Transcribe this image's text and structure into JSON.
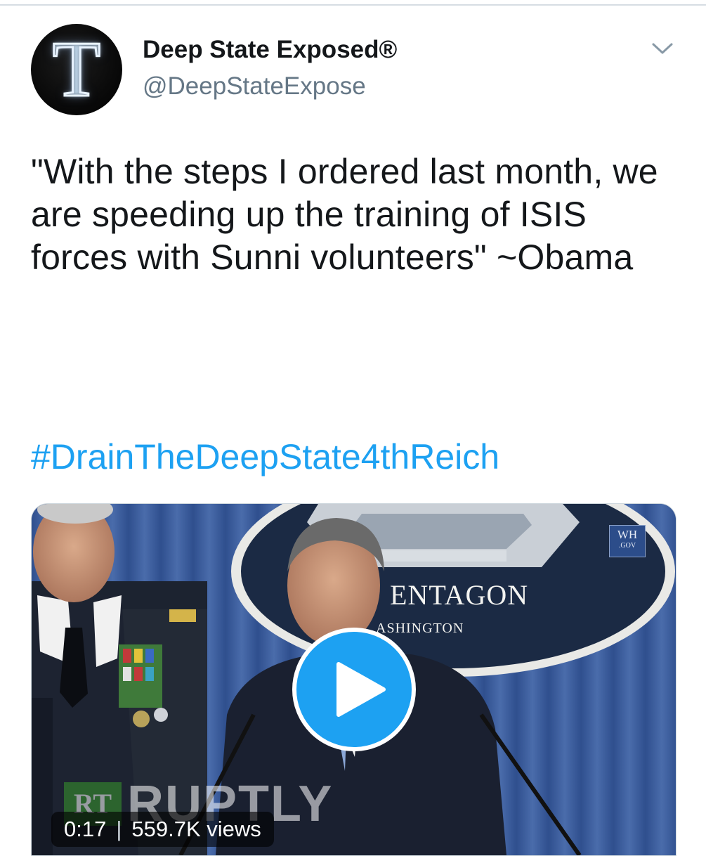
{
  "tweet": {
    "author": {
      "display_name": "Deep State Exposed®",
      "handle": "@DeepStateExpose",
      "avatar_icon": "neon-letter-t-avatar",
      "avatar_letter": "T"
    },
    "menu_icon": "chevron-down-icon",
    "text": "\"With the steps I ordered last month, we are speeding up the training of ISIS forces with Sunni volunteers\" ~Obama",
    "hashtag": "#DrainTheDeepState4thReich"
  },
  "video": {
    "duration": "0:17",
    "views": "559.7K views",
    "play_icon": "play-icon",
    "badge": {
      "line1": "WH",
      "line2": ".GOV"
    },
    "seal_text": "ENTAGON",
    "seal_subtext": "ASHINGTON",
    "watermark": {
      "logo": "RT",
      "text": "RUPTLY"
    }
  },
  "colors": {
    "accent": "#1da1f2",
    "text_primary": "#14171a",
    "text_secondary": "#657786"
  }
}
